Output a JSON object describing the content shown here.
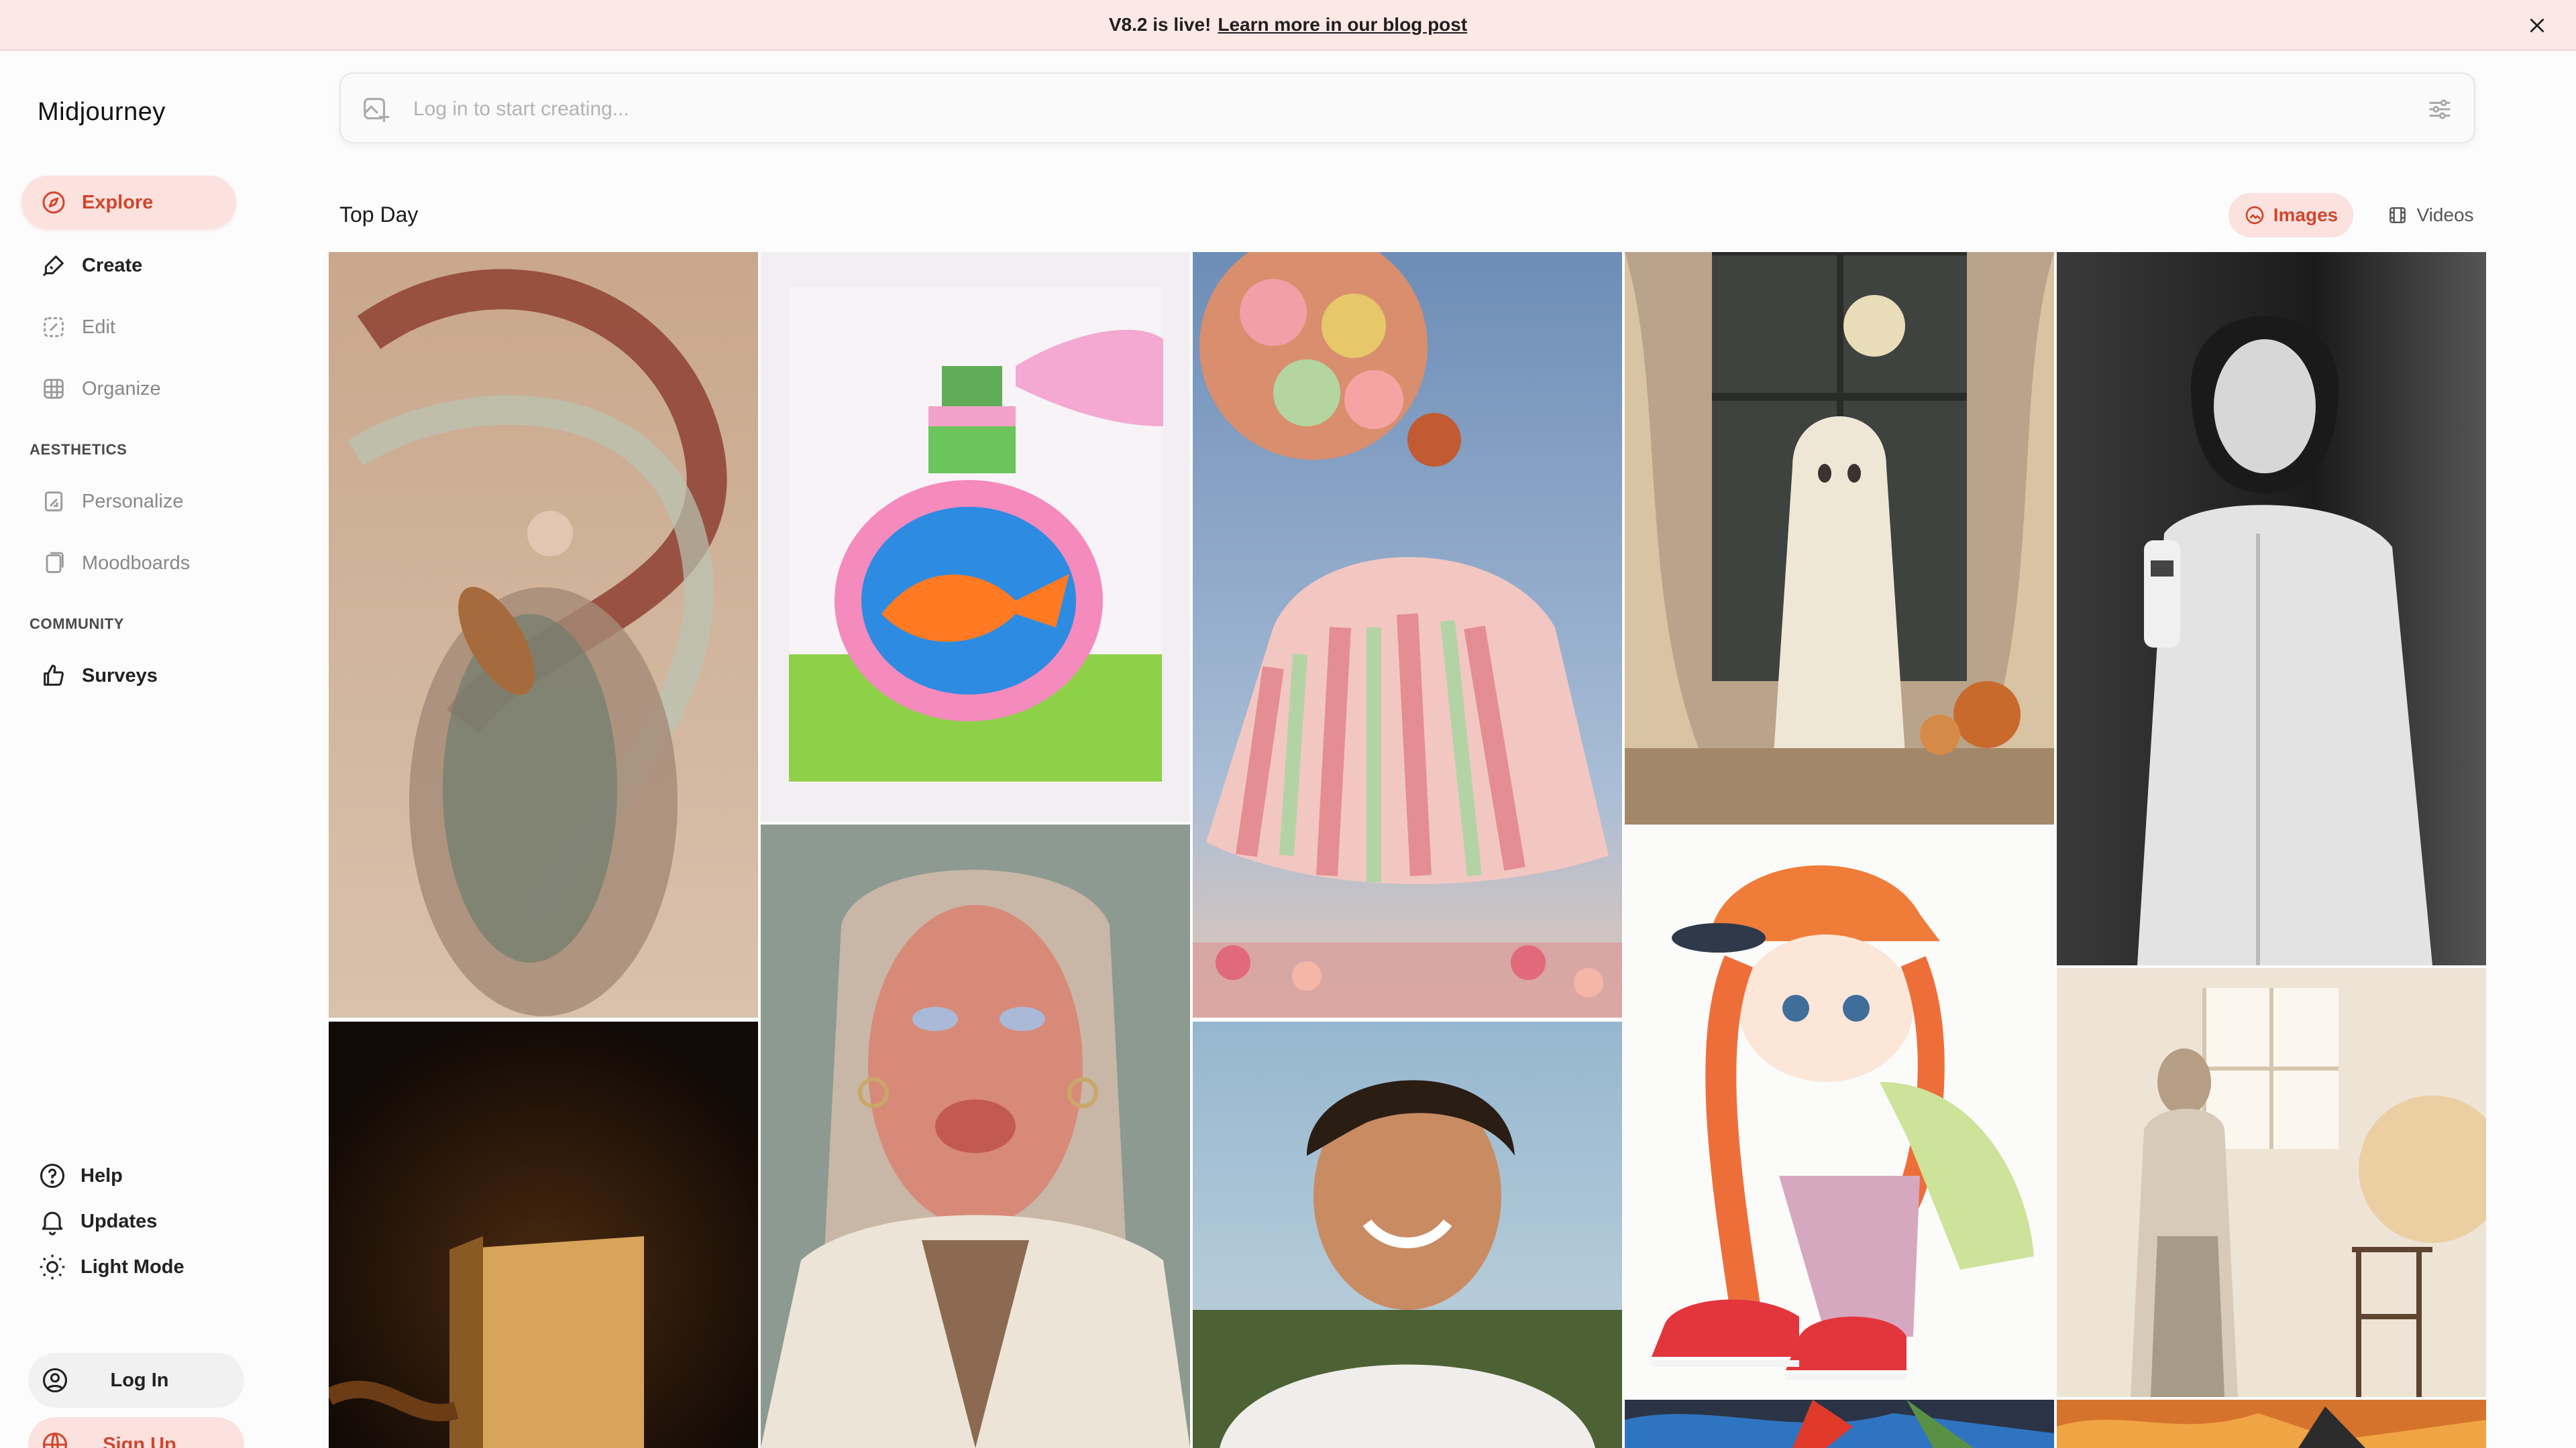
{
  "banner": {
    "message": "V8.2 is live!",
    "link": "Learn more in our blog post"
  },
  "app": {
    "name": "Midjourney"
  },
  "nav": {
    "explore": "Explore",
    "create": "Create",
    "edit": "Edit",
    "organize": "Organize",
    "aesthetics_header": "AESTHETICS",
    "personalize": "Personalize",
    "moodboards": "Moodboards",
    "community_header": "COMMUNITY",
    "surveys": "Surveys"
  },
  "footer_nav": {
    "help": "Help",
    "updates": "Updates",
    "light_mode": "Light Mode",
    "log_in": "Log In",
    "sign_up": "Sign Up"
  },
  "search": {
    "placeholder": "Log in to start creating..."
  },
  "feed": {
    "title": "Top Day",
    "tab_images": "Images",
    "tab_videos": "Videos",
    "active_tab": "Images"
  },
  "colors": {
    "accent": "#d2452e",
    "accent_bg": "#fbe2de",
    "banner_bg": "#fce8e4"
  },
  "gallery": [
    {
      "name": "dancer-with-pipa",
      "desc_icon": "image"
    },
    {
      "name": "perfume-bottle-fish",
      "desc_icon": "image"
    },
    {
      "name": "pastel-dress-jump",
      "desc_icon": "image"
    },
    {
      "name": "ghost-window-pumpkins",
      "desc_icon": "image"
    },
    {
      "name": "bw-portrait-water-bottle",
      "desc_icon": "image"
    },
    {
      "name": "glossy-face-fur-coat",
      "desc_icon": "image"
    },
    {
      "name": "dark-doorway-light",
      "desc_icon": "image"
    },
    {
      "name": "smiling-boy-portrait",
      "desc_icon": "image"
    },
    {
      "name": "anime-girl-red-cap",
      "desc_icon": "image"
    },
    {
      "name": "watercolor-woman-window",
      "desc_icon": "image"
    },
    {
      "name": "colorful-abstract-partial",
      "desc_icon": "image"
    },
    {
      "name": "fiery-abstract-partial",
      "desc_icon": "image"
    }
  ]
}
